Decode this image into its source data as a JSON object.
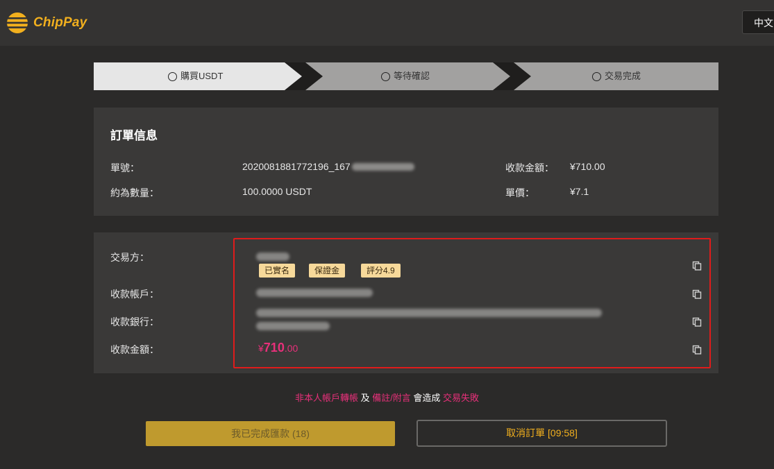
{
  "header": {
    "brand": "ChipPay",
    "language": "中文"
  },
  "steps": [
    {
      "label": "購買USDT",
      "active": true
    },
    {
      "label": "等待確認",
      "active": false
    },
    {
      "label": "交易完成",
      "active": false
    }
  ],
  "order_info": {
    "title": "訂單信息",
    "order_no_label": "單號：",
    "order_no_value": "2020081881772196_167",
    "approx_qty_label": "約為數量：",
    "approx_qty_value": "100.0000 USDT",
    "amount_label": "收款金額：",
    "amount_value": "¥710.00",
    "unit_price_label": "單價：",
    "unit_price_value": "¥7.1"
  },
  "payee": {
    "counterparty_label": "交易方：",
    "badges": [
      "已實名",
      "保證金",
      "評分4.9"
    ],
    "account_label": "收款帳戶：",
    "bank_label": "收款銀行：",
    "amount_label": "收款金額：",
    "amount_symbol": "¥",
    "amount_int": "710",
    "amount_dec": ".00"
  },
  "warning": {
    "part1": "非本人帳戶轉帳",
    "part2": " 及 ",
    "part3": "備註/附言",
    "part4": " 會造成 ",
    "part5": "交易失敗"
  },
  "buttons": {
    "done": "我已完成匯款 (18)",
    "cancel": "取消訂單 [09:58]"
  },
  "colors": {
    "accent": "#f2b01e",
    "pink": "#e8307a",
    "highlight_border": "#e01b1b"
  }
}
